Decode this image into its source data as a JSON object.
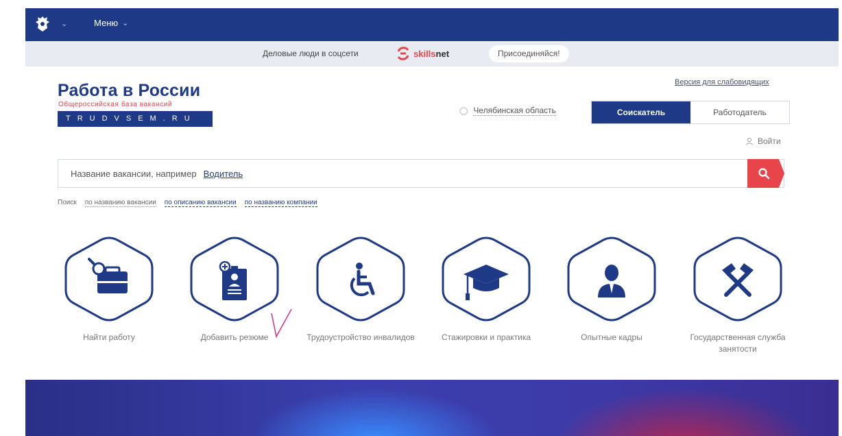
{
  "topbar": {
    "menu_label": "Меню"
  },
  "promo": {
    "text": "Деловые люди в соцсети",
    "brand_part1": "skills",
    "brand_part2": "net",
    "join_label": "Присоединяйся!"
  },
  "logo": {
    "title": "Работа в России",
    "subtitle": "Общероссийская база вакансий",
    "domain": "TRUDVSEM.RU"
  },
  "header": {
    "vision_link": "Версия для слабовидящих",
    "region": "Челябинская область",
    "roles": [
      "Соискатель",
      "Работодатель"
    ],
    "login": "Войти"
  },
  "search": {
    "placeholder": "Название вакансии, например",
    "example": "Водитель",
    "options_label": "Поиск",
    "options": [
      "по названию вакансии",
      "по описанию вакансии",
      "по названию компании"
    ]
  },
  "categories": [
    {
      "label": "Найти работу",
      "icon": "briefcase-search-icon"
    },
    {
      "label": "Добавить резюме",
      "icon": "add-resume-icon"
    },
    {
      "label": "Трудоустройство инвалидов",
      "icon": "wheelchair-icon"
    },
    {
      "label": "Стажировки и практика",
      "icon": "graduation-cap-icon"
    },
    {
      "label": "Опытные кадры",
      "icon": "person-icon"
    },
    {
      "label": "Государственная служба занятости",
      "icon": "hammers-icon"
    }
  ],
  "colors": {
    "brand_blue": "#1e3a86",
    "accent_red": "#e8454a"
  }
}
